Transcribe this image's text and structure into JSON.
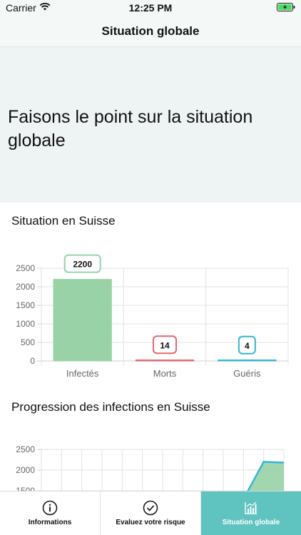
{
  "status": {
    "carrier": "Carrier",
    "time": "12:25 PM"
  },
  "nav": {
    "title": "Situation globale"
  },
  "hero": {
    "text": "Faisons le point sur la situation globale"
  },
  "sections": {
    "situation_title": "Situation en Suisse",
    "progression_title": "Progression des infections en Suisse"
  },
  "chart_data": [
    {
      "type": "bar",
      "categories": [
        "Infectés",
        "Morts",
        "Guéris"
      ],
      "values": [
        2200,
        14,
        4
      ],
      "ylim": [
        0,
        2500
      ],
      "yticks": [
        0,
        500,
        1000,
        1500,
        2000,
        2500
      ],
      "grid": true,
      "colors": [
        "#98d2a6",
        "#e06870",
        "#35b4d8"
      ]
    },
    {
      "type": "area",
      "ylim": [
        0,
        2500
      ],
      "yticks": [
        1500,
        2000,
        2500
      ],
      "grid": true,
      "x": [
        0,
        1,
        2,
        3,
        4,
        5,
        6,
        7,
        8,
        9,
        10,
        11,
        12
      ],
      "values": [
        0,
        0,
        0,
        0,
        0,
        0,
        0,
        0,
        0,
        0,
        1300,
        2200,
        2180
      ],
      "color": "#98d2a6"
    }
  ],
  "tabs": [
    {
      "label": "Informations",
      "icon": "info-icon"
    },
    {
      "label": "Evaluez votre risque",
      "icon": "check-circle-icon"
    },
    {
      "label": "Situation globale",
      "icon": "chart-icon"
    }
  ]
}
